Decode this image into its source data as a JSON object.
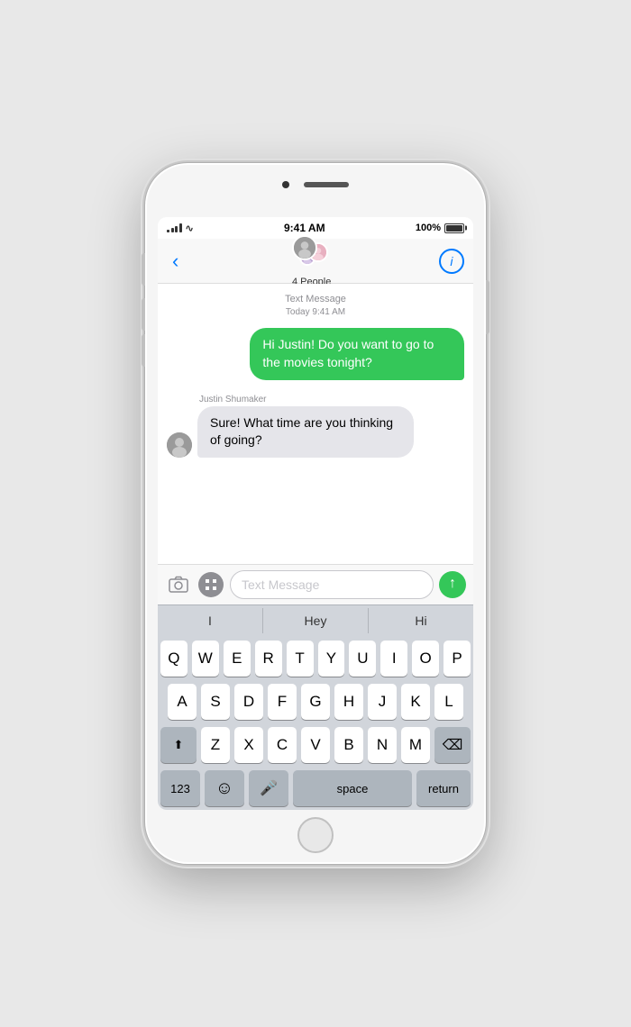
{
  "phone": {
    "notch": {
      "camera": "camera",
      "speaker": "speaker"
    }
  },
  "status_bar": {
    "time": "9:41 AM",
    "battery_level": "100%",
    "battery_label": "100%"
  },
  "nav": {
    "back_label": "‹",
    "group_label": "4 People",
    "info_label": "i"
  },
  "message_meta": {
    "type": "Text Message",
    "timestamp": "Today 9:41 AM"
  },
  "messages": [
    {
      "id": "msg1",
      "type": "sent",
      "text": "Hi Justin! Do you want to go to the movies tonight?"
    },
    {
      "id": "msg2",
      "type": "received",
      "sender": "Justin Shumaker",
      "text": "Sure! What time are you thinking of going?"
    }
  ],
  "input": {
    "placeholder": "Text Message",
    "send_label": "↑"
  },
  "predictive": {
    "items": [
      "I",
      "Hey",
      "Hi"
    ]
  },
  "keyboard": {
    "rows": [
      [
        "Q",
        "W",
        "E",
        "R",
        "T",
        "Y",
        "U",
        "I",
        "O",
        "P"
      ],
      [
        "A",
        "S",
        "D",
        "F",
        "G",
        "H",
        "J",
        "K",
        "L"
      ],
      [
        "Z",
        "X",
        "C",
        "V",
        "B",
        "N",
        "M"
      ]
    ],
    "special": {
      "shift": "⬆",
      "delete": "⌫",
      "nums": "123",
      "emoji": "☺",
      "mic": "🎤",
      "space": "space",
      "return": "return"
    }
  }
}
